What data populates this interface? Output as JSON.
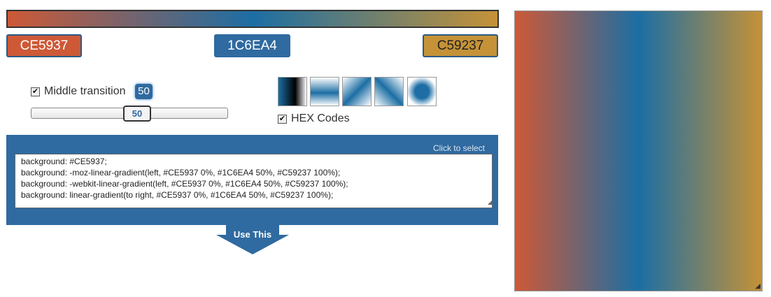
{
  "colors": {
    "start": "#CE5937",
    "middle": "#1C6EA4",
    "end": "#C59237",
    "panel": "#2f6aa0"
  },
  "stops": {
    "left_label": "CE5937",
    "middle_label": "1C6EA4",
    "right_label": "C59237"
  },
  "controls": {
    "middle_transition_label": "Middle transition",
    "middle_transition_checked": true,
    "middle_value": "50",
    "slider_value": "50",
    "hex_codes_label": "HEX Codes",
    "hex_codes_checked": true
  },
  "swatches": [
    "linear-horizontal-dark",
    "linear-vertical",
    "linear-diagonal-1",
    "linear-diagonal-2",
    "radial"
  ],
  "code": {
    "hint": "Click to select",
    "text": "background: #CE5937;\nbackground: -moz-linear-gradient(left, #CE5937 0%, #1C6EA4 50%, #C59237 100%);\nbackground: -webkit-linear-gradient(left, #CE5937 0%, #1C6EA4 50%, #C59237 100%);\nbackground: linear-gradient(to right, #CE5937 0%, #1C6EA4 50%, #C59237 100%);"
  },
  "use_this_label": "Use This"
}
